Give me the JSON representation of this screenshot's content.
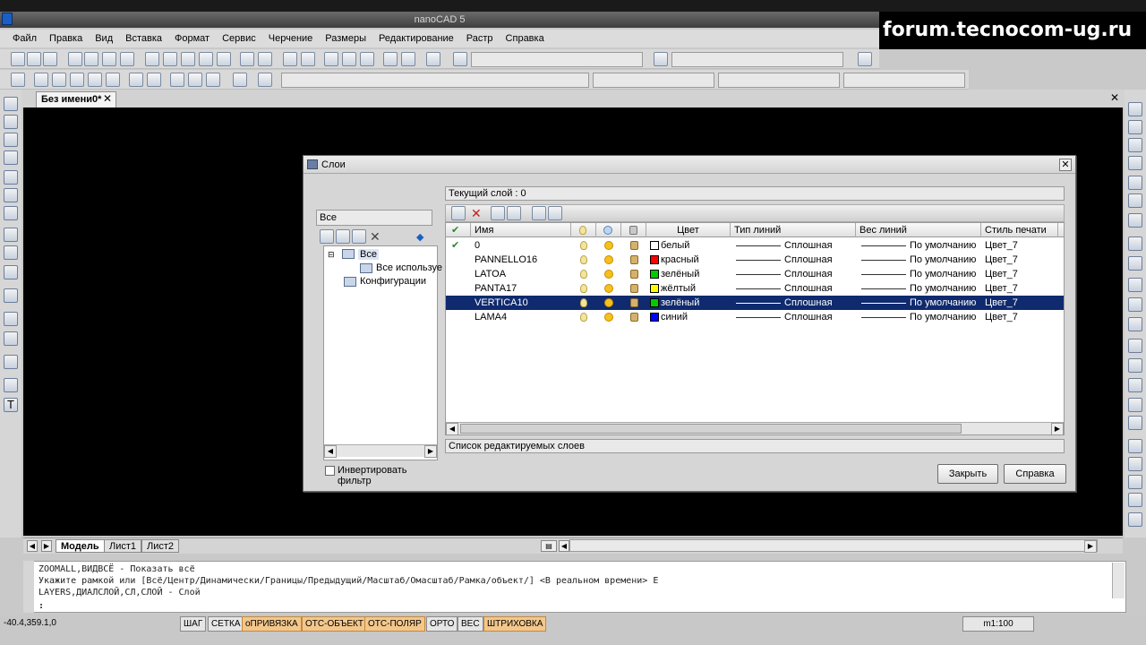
{
  "window": {
    "title": "nanoCAD 5",
    "watermark": "forum.tecnocom-ug.ru"
  },
  "menu": [
    "Файл",
    "Правка",
    "Вид",
    "Вставка",
    "Формат",
    "Сервис",
    "Черчение",
    "Размеры",
    "Редактирование",
    "Растр",
    "Справка"
  ],
  "document": {
    "tab_label": "Без имени0*",
    "close_glyph": "✕"
  },
  "sheets": [
    "Модель",
    "Лист1",
    "Лист2"
  ],
  "command_lines": [
    "ZOOMALL,ВИДВСЁ - Показать всё",
    "Укажите рамкой или [Всё/Центр/Динамически/Границы/Предыдущий/Масштаб/Омасштаб/Рамка/объект/] <В реальном времени> E",
    "LAYERS,ДИАЛСЛОЙ,СЛ,СЛОЙ - Слой",
    ":"
  ],
  "status": {
    "coords": "-40.4,359.1,0",
    "buttons": [
      {
        "label": "ШАГ",
        "on": false
      },
      {
        "label": "СЕТКА",
        "on": false
      },
      {
        "label": "оПРИВЯЗКА",
        "on": true
      },
      {
        "label": "ОТС-ОБЪЕКТ",
        "on": true
      },
      {
        "label": "ОТС-ПОЛЯР",
        "on": true
      },
      {
        "label": "ОРТО",
        "on": false
      },
      {
        "label": "ВЕС",
        "on": false
      },
      {
        "label": "ШТРИХОВКА",
        "on": true
      }
    ],
    "scale": "m1:100"
  },
  "dialog": {
    "title": "Слои",
    "filter_combo": "Все",
    "tree": {
      "root": "Все",
      "child": "Все используе",
      "configs": "Конфигурации"
    },
    "invert_filter_label": "Инвертировать фильтр",
    "current_layer": "Текущий слой : 0",
    "list_status": "Список редактируемых слоев",
    "columns": [
      "Имя",
      "Цвет",
      "Тип линий",
      "Вес линий",
      "Стиль печати"
    ],
    "layers": [
      {
        "name": "0",
        "current": true,
        "color_name": "белый",
        "color": "#ffffff",
        "linetype": "Сплошная",
        "weight": "По умолчанию",
        "plot": "Цвет_7",
        "selected": false
      },
      {
        "name": "PANNELLO16",
        "current": false,
        "color_name": "красный",
        "color": "#ff0000",
        "linetype": "Сплошная",
        "weight": "По умолчанию",
        "plot": "Цвет_7",
        "selected": false
      },
      {
        "name": "LATOA",
        "current": false,
        "color_name": "зелёный",
        "color": "#00cc00",
        "linetype": "Сплошная",
        "weight": "По умолчанию",
        "plot": "Цвет_7",
        "selected": false
      },
      {
        "name": "PANTA17",
        "current": false,
        "color_name": "жёлтый",
        "color": "#ffff00",
        "linetype": "Сплошная",
        "weight": "По умолчанию",
        "plot": "Цвет_7",
        "selected": false
      },
      {
        "name": "VERTICA10",
        "current": false,
        "color_name": "зелёный",
        "color": "#00cc00",
        "linetype": "Сплошная",
        "weight": "По умолчанию",
        "plot": "Цвет_7",
        "selected": true
      },
      {
        "name": "LAMA4",
        "current": false,
        "color_name": "синий",
        "color": "#0000ff",
        "linetype": "Сплошная",
        "weight": "По умолчанию",
        "plot": "Цвет_7",
        "selected": false
      }
    ],
    "close_button": "Закрыть",
    "help_button": "Справка",
    "close_glyph": "✕"
  }
}
